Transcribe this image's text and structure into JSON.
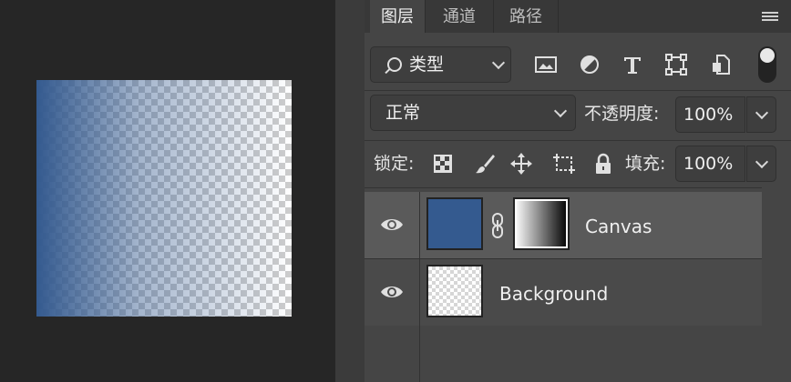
{
  "canvas": {
    "gradient_colors": [
      "#345a8f",
      "#ffffff"
    ],
    "transparency": "checkerboard"
  },
  "panel": {
    "tabs": [
      {
        "label": "图层",
        "active": true
      },
      {
        "label": "通道",
        "active": false
      },
      {
        "label": "路径",
        "active": false
      }
    ],
    "menu_icon": "hamburger-icon",
    "filter": {
      "kind_label": "类型",
      "icons": [
        "image-icon",
        "adjustment-icon",
        "type-icon",
        "shape-icon",
        "smart-object-icon"
      ],
      "toggle_on": true
    },
    "blend": {
      "mode": "正常",
      "opacity_label": "不透明度:",
      "opacity_value": "100%"
    },
    "lock": {
      "label": "锁定:",
      "icons": [
        "lock-transparent-icon",
        "lock-pixels-icon",
        "lock-position-icon",
        "lock-artboard-icon",
        "lock-all-icon"
      ],
      "fill_label": "填充:",
      "fill_value": "100%"
    },
    "layers": [
      {
        "name": "Canvas",
        "visible": true,
        "selected": true,
        "color": "#345a8f",
        "has_mask": true
      },
      {
        "name": "Background",
        "visible": true,
        "selected": false
      }
    ]
  }
}
